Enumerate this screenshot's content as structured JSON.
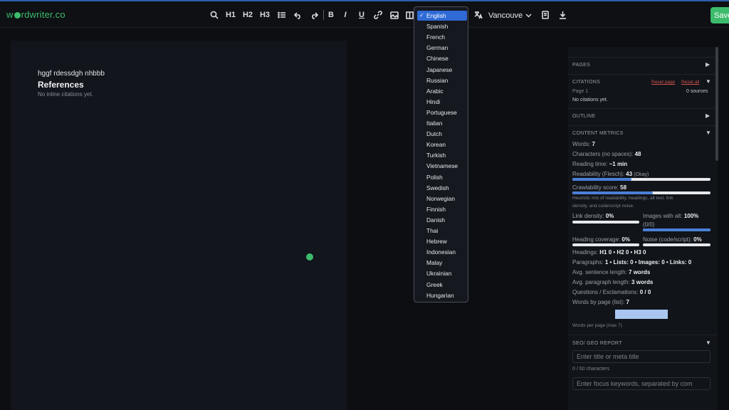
{
  "app": {
    "logo_text_a": "w",
    "logo_text_b": "rdwriter.co",
    "logo_color": "#3dbb6c",
    "accent": "#2f6ad6"
  },
  "toolbar": {
    "h1": "H1",
    "h2": "H2",
    "h3": "H3",
    "bold": "B",
    "italic": "I",
    "underline": "U",
    "voice_value": "Vancouve",
    "save_label": "Save"
  },
  "language_menu": {
    "selected": "English",
    "options": [
      "English",
      "Spanish",
      "French",
      "German",
      "Chinese",
      "Japanese",
      "Russian",
      "Arabic",
      "Hindi",
      "Portuguese",
      "Italian",
      "Dutch",
      "Korean",
      "Turkish",
      "Vietnamese",
      "Polish",
      "Swedish",
      "Norwegian",
      "Finnish",
      "Danish",
      "Thai",
      "Hebrew",
      "Indonesian",
      "Malay",
      "Ukrainian",
      "Greek",
      "Hungarian"
    ]
  },
  "editor": {
    "body_text": "hggf rdessdgh nhbbb",
    "references_heading": "References",
    "references_note": "No inline citations yet."
  },
  "panel": {
    "pages_label": "PAGES",
    "citations_label": "CITATIONS",
    "reset_page": "Reset page",
    "reset_all": "Reset all",
    "page_label": "Page 1",
    "sources_count": "0 sources",
    "no_citations": "No citations yet.",
    "outline_label": "OUTLINE",
    "metrics_label": "CONTENT METRICS",
    "words_label": "Words:",
    "words_value": "7",
    "chars_label": "Characters (no spaces):",
    "chars_value": "48",
    "reading_label": "Reading time:",
    "reading_value": "~1 min",
    "readability_label": "Readability (Flesch):",
    "readability_value": "43",
    "readability_note": "(Okay)",
    "readability_level": 0.43,
    "crawl_label": "Crawlability score:",
    "crawl_value": "58",
    "crawl_level": 0.58,
    "crawl_desc_1": "Heuristic mix of readability, headings, alt text, link",
    "crawl_desc_2": "density, and code/script noise.",
    "link_density_label": "Link density:",
    "link_density_value": "0%",
    "images_alt_label": "Images with alt:",
    "images_alt_value": "100%",
    "images_alt_note": "(0/0)",
    "images_alt_level": 1.0,
    "heading_cov_label": "Heading coverage:",
    "heading_cov_value": "0%",
    "noise_label": "Noise (code/script):",
    "noise_value": "0%",
    "headings_label": "Headings:",
    "headings_value": "H1 0 • H2 0 • H3 0",
    "paragraphs_label": "Paragraphs:",
    "paragraphs_value": "1 • Lists: 0 • Images: 0 • Links: 0",
    "avg_sentence_label": "Avg. sentence length:",
    "avg_sentence_value": "7 words",
    "avg_paragraph_label": "Avg. paragraph length:",
    "avg_paragraph_value": "3 words",
    "questions_label": "Questions / Exclamations:",
    "questions_value": "0 / 0",
    "words_by_page_label": "Words by page (list):",
    "words_by_page_value": "7",
    "words_per_page_caption": "Words per page (max 7)",
    "seo_label": "SEO/ GEO REPORT",
    "title_placeholder": "Enter title or meta title",
    "title_count": "0 / 60 characters",
    "keywords_placeholder": "Enter focus keywords, separated by com"
  }
}
